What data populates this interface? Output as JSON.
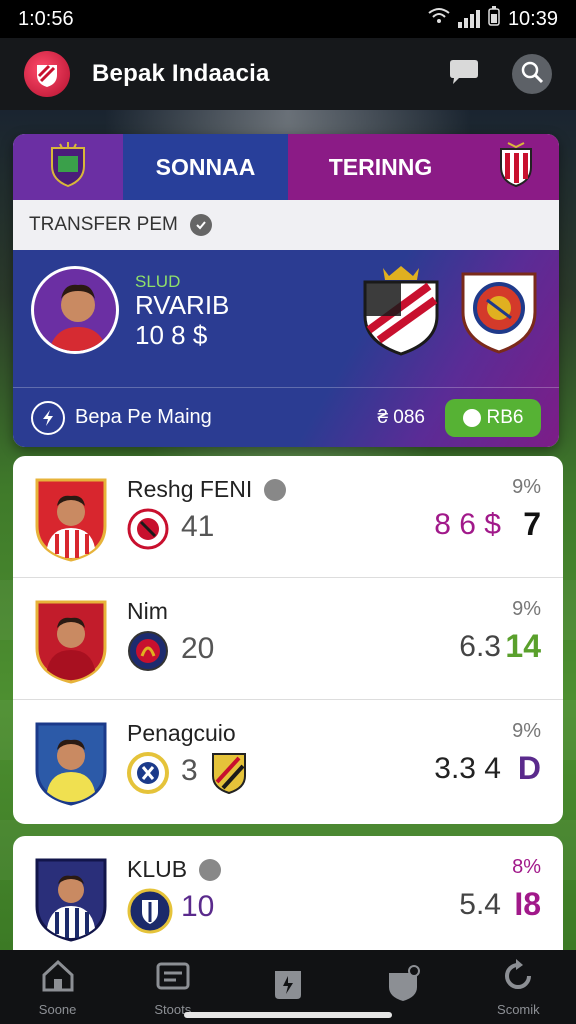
{
  "status_bar": {
    "time": "1:0:56",
    "clock": "10:39"
  },
  "app_bar": {
    "title": "Bepak Indaacia"
  },
  "transfer_card": {
    "tabs": [
      "SONNAA",
      "TERINNG"
    ],
    "section_label": "TRANSFER PEM",
    "player": {
      "club_tag": "SLUD",
      "name": "RVARIB",
      "fee": "10 8 $"
    },
    "footer_label": "Bepa Pe Maing",
    "footer_value": "₴ 086",
    "rate_button": "RB6"
  },
  "players": [
    {
      "name": "Reshg FENI",
      "number": "41",
      "pct": "9%",
      "value": "8 6 $",
      "score": "7",
      "score_color": "#111111",
      "avatar_color": "#d8262e",
      "crest_colors": [
        "#c8102e",
        "#ffffff"
      ]
    },
    {
      "name": "Nim",
      "number": "20",
      "pct": "9%",
      "value": "6.3",
      "score": "14",
      "score_color": "#5aa02c",
      "avatar_color": "#c21c2b",
      "crest_colors": [
        "#1d2b6e",
        "#c8102e"
      ]
    },
    {
      "name": "Penagcuio",
      "number": "3",
      "pct": "9%",
      "value": "3.3 4",
      "score": "D",
      "score_color": "#5a2a8c",
      "avatar_color": "#2c5aa8",
      "crest_colors": [
        "#1b3a8a",
        "#e5c33a"
      ]
    }
  ],
  "club_row": {
    "name": "KLUB",
    "number": "10",
    "pct": "8%",
    "value": "5.4",
    "score": "I8",
    "score_color": "#a1198a"
  },
  "bottom_nav": [
    {
      "label": "Soone",
      "icon": "home-icon"
    },
    {
      "label": "Stoots",
      "icon": "stats-icon"
    },
    {
      "label": "",
      "icon": "shirt-icon"
    },
    {
      "label": "",
      "icon": "shield-icon"
    },
    {
      "label": "Scomik",
      "icon": "refresh-icon"
    }
  ]
}
